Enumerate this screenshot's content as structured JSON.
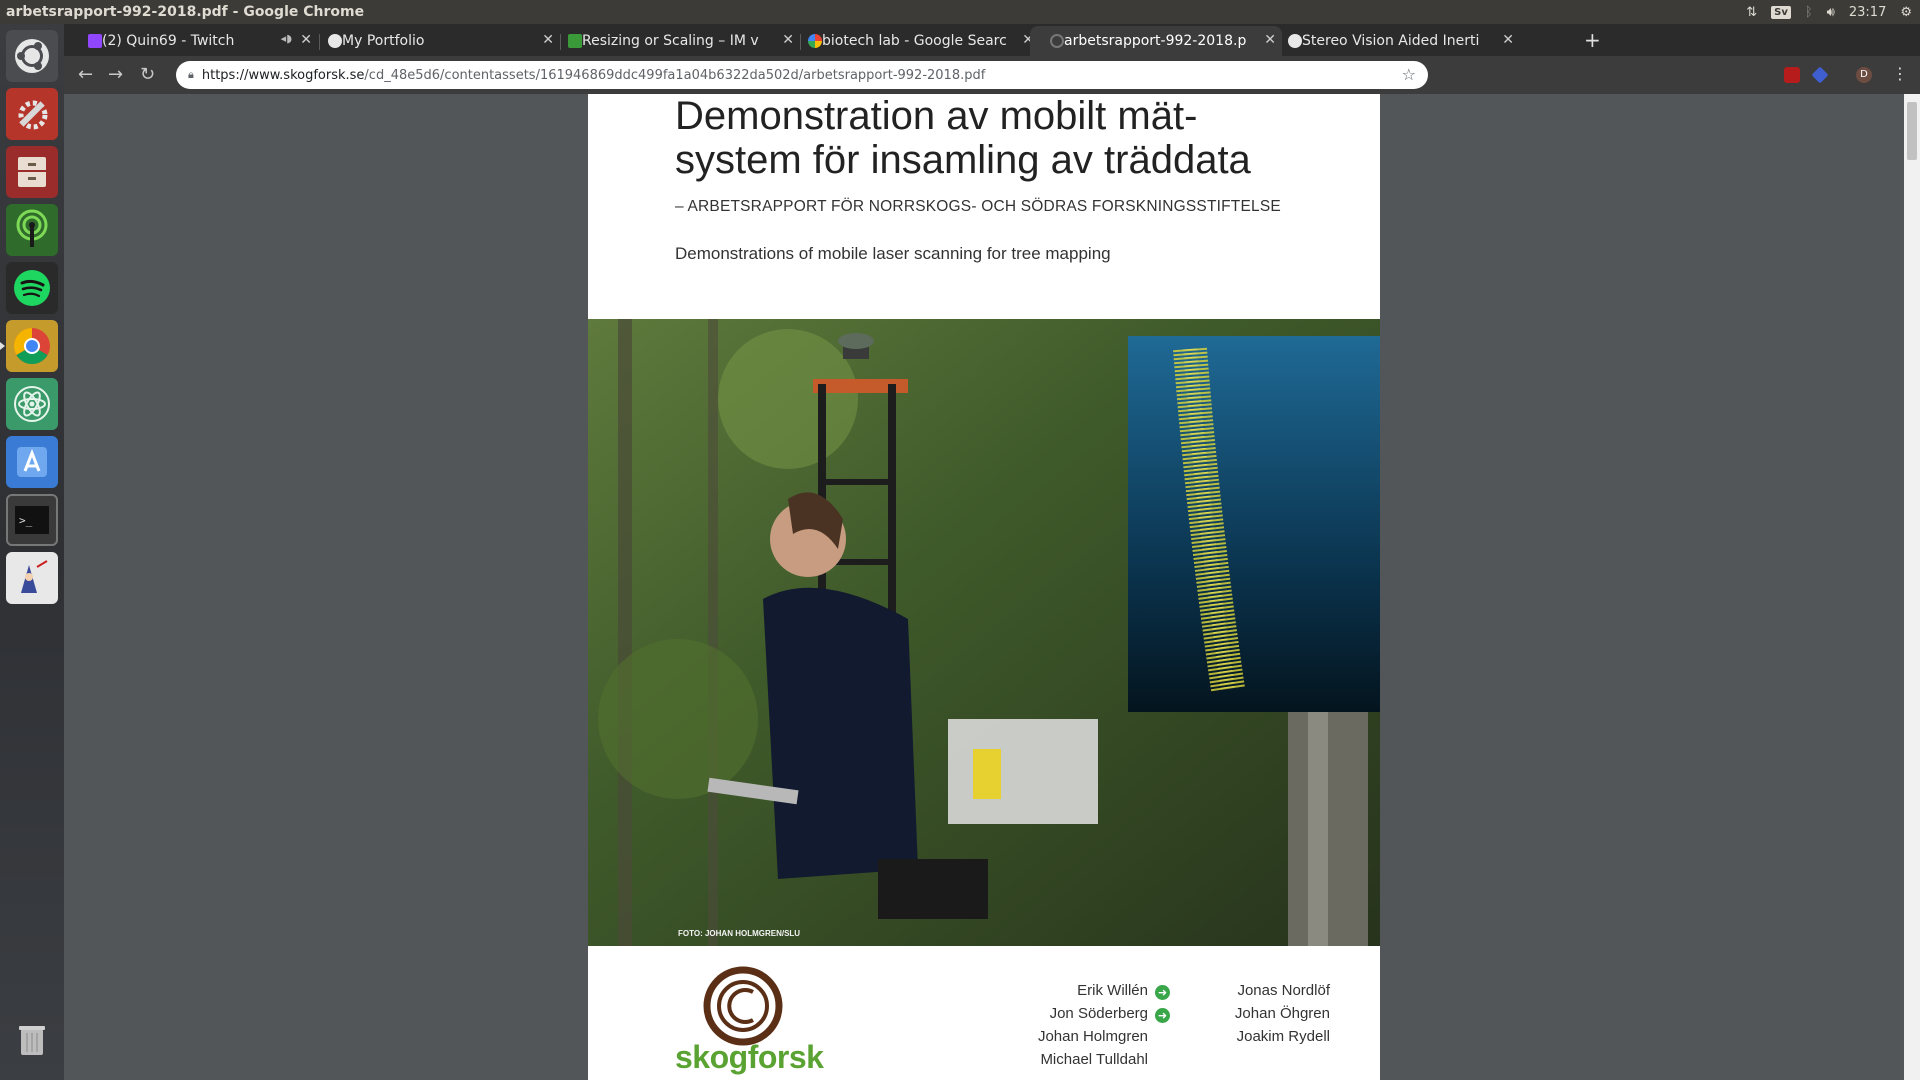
{
  "window": {
    "title": "arbetsrapport-992-2018.pdf - Google Chrome"
  },
  "tray": {
    "language": "Sv",
    "time": "23:17"
  },
  "tabs": [
    {
      "label": "(2) Quin69 - Twitch",
      "active": false
    },
    {
      "label": "My Portfolio",
      "active": false
    },
    {
      "label": "Resizing or Scaling – IM v",
      "active": false
    },
    {
      "label": "biotech lab - Google Searc",
      "active": false
    },
    {
      "label": "arbetsrapport-992-2018.p",
      "active": true
    },
    {
      "label": "Stereo Vision Aided Inerti",
      "active": false
    }
  ],
  "omnibox": {
    "url_host": "https://www.skogforsk.se",
    "url_path": "/cd_48e5d6/contentassets/161946869ddc499fa1a04b6322da502d/arbetsrapport-992-2018.pdf"
  },
  "profile": {
    "initial": "D"
  },
  "document": {
    "title": "Demonstration av mobilt mät-system för insamling av träddata",
    "subtitle": "– ARBETSRAPPORT FÖR NORRSKOGS- OCH SÖDRAS FORSKNINGSSTIFTELSE",
    "english_title": "Demonstrations of mobile laser scanning for tree mapping",
    "photo_credit": "FOTO: JOHAN HOLMGREN/SLU",
    "logo_text": "skogforsk",
    "authors_left": [
      "Erik Willén",
      "Jon Söderberg",
      "Johan Holmgren",
      "Michael  Tulldahl"
    ],
    "authors_right": [
      "Jonas Nordlöf",
      "Johan Öhgren",
      "Joakim Rydell"
    ]
  },
  "colors": {
    "skogforsk_green": "#5aa332",
    "skogforsk_brown": "#5a2f16",
    "author_badge": "#3aa64a"
  }
}
